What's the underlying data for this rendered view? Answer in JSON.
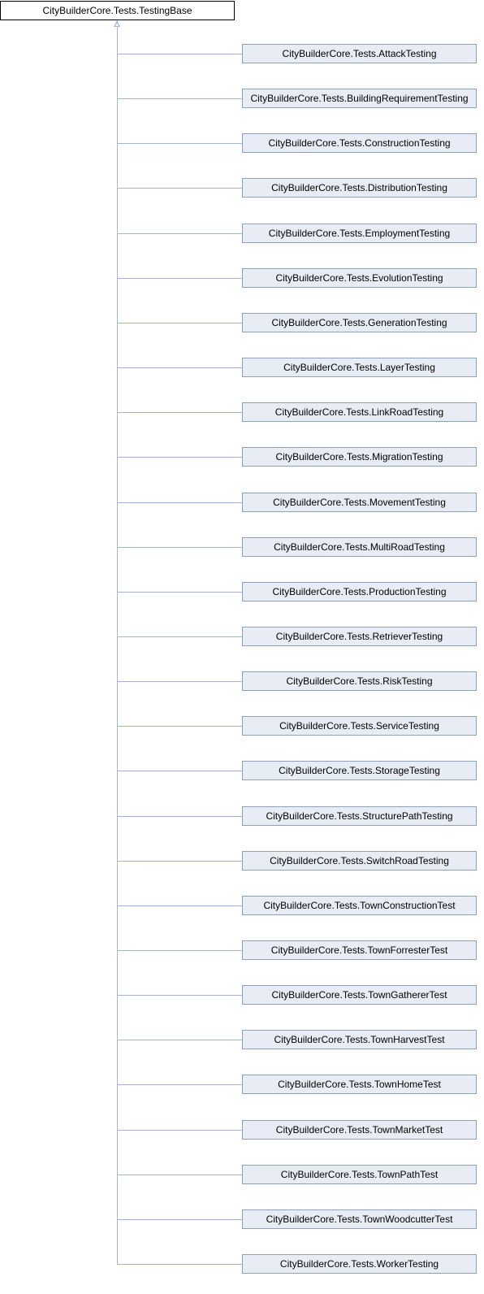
{
  "base_class": "CityBuilderCore.Tests.TestingBase",
  "derived_classes": [
    "CityBuilderCore.Tests.AttackTesting",
    "CityBuilderCore.Tests.BuildingRequirementTesting",
    "CityBuilderCore.Tests.ConstructionTesting",
    "CityBuilderCore.Tests.DistributionTesting",
    "CityBuilderCore.Tests.EmploymentTesting",
    "CityBuilderCore.Tests.EvolutionTesting",
    "CityBuilderCore.Tests.GenerationTesting",
    "CityBuilderCore.Tests.LayerTesting",
    "CityBuilderCore.Tests.LinkRoadTesting",
    "CityBuilderCore.Tests.MigrationTesting",
    "CityBuilderCore.Tests.MovementTesting",
    "CityBuilderCore.Tests.MultiRoadTesting",
    "CityBuilderCore.Tests.ProductionTesting",
    "CityBuilderCore.Tests.RetrieverTesting",
    "CityBuilderCore.Tests.RiskTesting",
    "CityBuilderCore.Tests.ServiceTesting",
    "CityBuilderCore.Tests.StorageTesting",
    "CityBuilderCore.Tests.StructurePathTesting",
    "CityBuilderCore.Tests.SwitchRoadTesting",
    "CityBuilderCore.Tests.TownConstructionTest",
    "CityBuilderCore.Tests.TownForresterTest",
    "CityBuilderCore.Tests.TownGathererTest",
    "CityBuilderCore.Tests.TownHarvestTest",
    "CityBuilderCore.Tests.TownHomeTest",
    "CityBuilderCore.Tests.TownMarketTest",
    "CityBuilderCore.Tests.TownPathTest",
    "CityBuilderCore.Tests.TownWoodcutterTest",
    "CityBuilderCore.Tests.WorkerTesting"
  ],
  "colors": {
    "base_fill": "#ffffff",
    "base_border": "#000000",
    "child_fill": "#e8edf5",
    "child_border": "#8e9fb8",
    "connector": "#a3b4d4"
  }
}
